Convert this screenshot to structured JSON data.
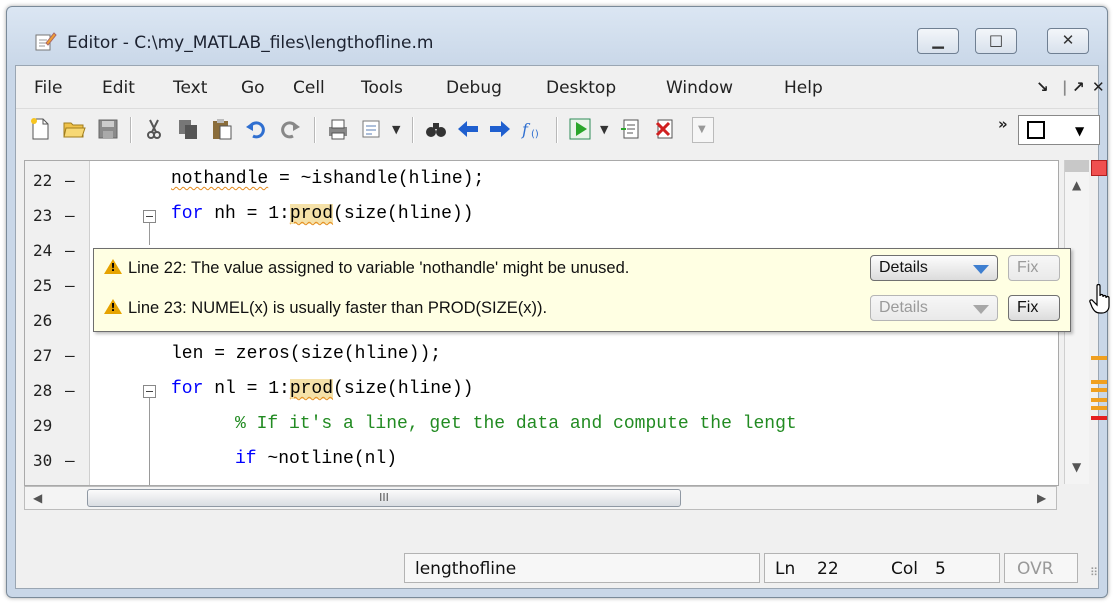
{
  "window": {
    "title": "Editor - C:\\my_MATLAB_files\\lengthofline.m",
    "controls": [
      "minimize",
      "maximize",
      "close"
    ]
  },
  "menu": {
    "items": [
      "File",
      "Edit",
      "Text",
      "Go",
      "Cell",
      "Tools",
      "Debug",
      "Desktop",
      "Window",
      "Help"
    ]
  },
  "toolbar": {
    "icons": [
      "new-file-icon",
      "open-folder-icon",
      "save-icon",
      "cut-icon",
      "copy-icon",
      "paste-icon",
      "undo-icon",
      "redo-icon",
      "print-icon",
      "comment-icon",
      "find-icon",
      "back-icon",
      "forward-icon",
      "function-icon",
      "run-icon",
      "step-icon",
      "clear-breakpoints-icon",
      "stack-dropdown",
      "layout-icon"
    ],
    "more": "»"
  },
  "editor": {
    "lines": [
      {
        "num": "22",
        "dash": "—"
      },
      {
        "num": "23",
        "dash": "—"
      },
      {
        "num": "24",
        "dash": "—"
      },
      {
        "num": "25",
        "dash": "—"
      },
      {
        "num": "26",
        "dash": ""
      },
      {
        "num": "27",
        "dash": "—"
      },
      {
        "num": "28",
        "dash": "—"
      },
      {
        "num": "29",
        "dash": ""
      },
      {
        "num": "30",
        "dash": "—"
      }
    ],
    "code": {
      "l22": {
        "var": "nothandle",
        "rest": " = ~ishandle(hline);"
      },
      "l23": {
        "kw": "for",
        "mid": " nh = 1:",
        "fn": "prod",
        "rest": "(size(hline))"
      },
      "l27": {
        "text": "len = zeros(size(hline));"
      },
      "l28": {
        "kw": "for",
        "mid": " nl = 1:",
        "fn": "prod",
        "rest": "(size(hline))"
      },
      "l29": {
        "comment": "% If it's a line, get the data and compute the lengt"
      },
      "l30": {
        "kw": "if",
        "rest": " ~notline(nl)"
      }
    }
  },
  "tooltip": {
    "messages": [
      {
        "text": "Line 22: The value assigned to variable 'nothandle' might be unused.",
        "details_label": "Details",
        "fix_label": "Fix",
        "details_enabled": true,
        "fix_enabled": false
      },
      {
        "text": "Line 23: NUMEL(x) is usually faster than PROD(SIZE(x)).",
        "details_label": "Details",
        "fix_label": "Fix",
        "details_enabled": false,
        "fix_enabled": true
      }
    ]
  },
  "scrollbar": {
    "grip": "III"
  },
  "status": {
    "function": "lengthofline",
    "ln_label": "Ln",
    "ln_value": "22",
    "col_label": "Col",
    "col_value": "5",
    "ovr": "OVR"
  },
  "colors": {
    "keyword": "#0000ff",
    "comment": "#228b22",
    "warning": "#e6a300",
    "error_marker": "#e52020",
    "tooltip_bg": "#ffffe3"
  }
}
